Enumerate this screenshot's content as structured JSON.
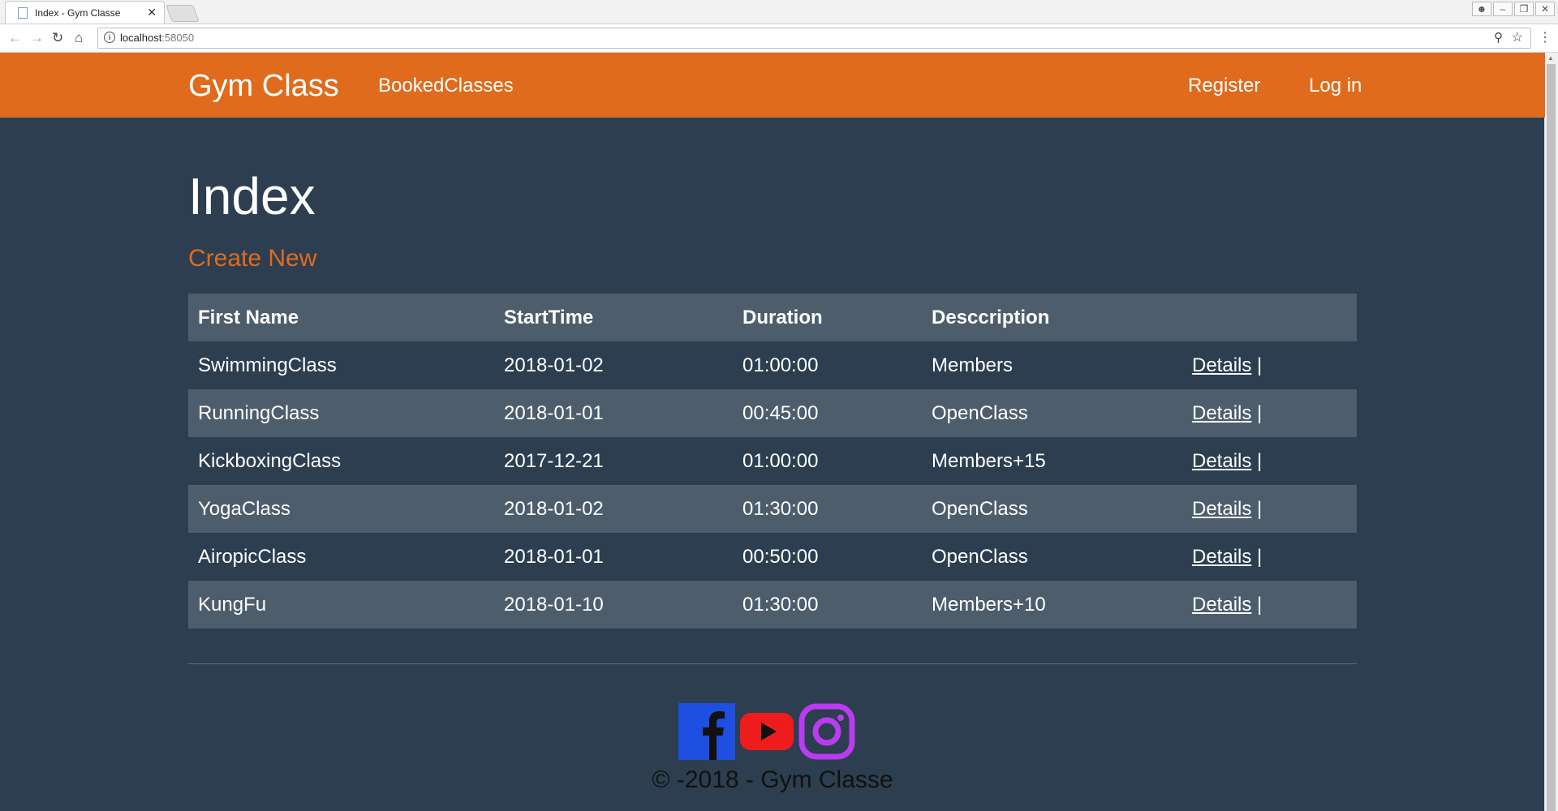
{
  "browser": {
    "tab_title": "Index - Gym Classe",
    "tab_close": "✕",
    "url_host": "localhost",
    "url_port": ":58050"
  },
  "navbar": {
    "brand": "Gym Class",
    "links": [
      "BookedClasses"
    ],
    "right_links": [
      "Register",
      "Log in"
    ],
    "color": "#e06b1d"
  },
  "main": {
    "title": "Index",
    "create_label": "Create New",
    "columns": [
      "First Name",
      "StartTime",
      "Duration",
      "Desccription"
    ],
    "rows": [
      {
        "name": "SwimmingClass",
        "start": "2018-01-02",
        "duration": "01:00:00",
        "description": "Members",
        "action": "Details",
        "sep": "|"
      },
      {
        "name": "RunningClass",
        "start": "2018-01-01",
        "duration": "00:45:00",
        "description": "OpenClass",
        "action": "Details",
        "sep": "|"
      },
      {
        "name": "KickboxingClass",
        "start": "2017-12-21",
        "duration": "01:00:00",
        "description": "Members+15",
        "action": "Details",
        "sep": "|"
      },
      {
        "name": "YogaClass",
        "start": "2018-01-02",
        "duration": "01:30:00",
        "description": "OpenClass",
        "action": "Details",
        "sep": "|"
      },
      {
        "name": "AiropicClass",
        "start": "2018-01-01",
        "duration": "00:50:00",
        "description": "OpenClass",
        "action": "Details",
        "sep": "|"
      },
      {
        "name": "KungFu",
        "start": "2018-01-10",
        "duration": "01:30:00",
        "description": "Members+10",
        "action": "Details",
        "sep": "|"
      }
    ]
  },
  "footer": {
    "social_icons": [
      "facebook-icon",
      "youtube-icon",
      "instagram-icon"
    ],
    "copyright": "© -2018 - Gym Classe"
  },
  "colors": {
    "background": "#2c3e50",
    "table_stripe": "#4e5d6c",
    "accent": "#e06b1d"
  }
}
